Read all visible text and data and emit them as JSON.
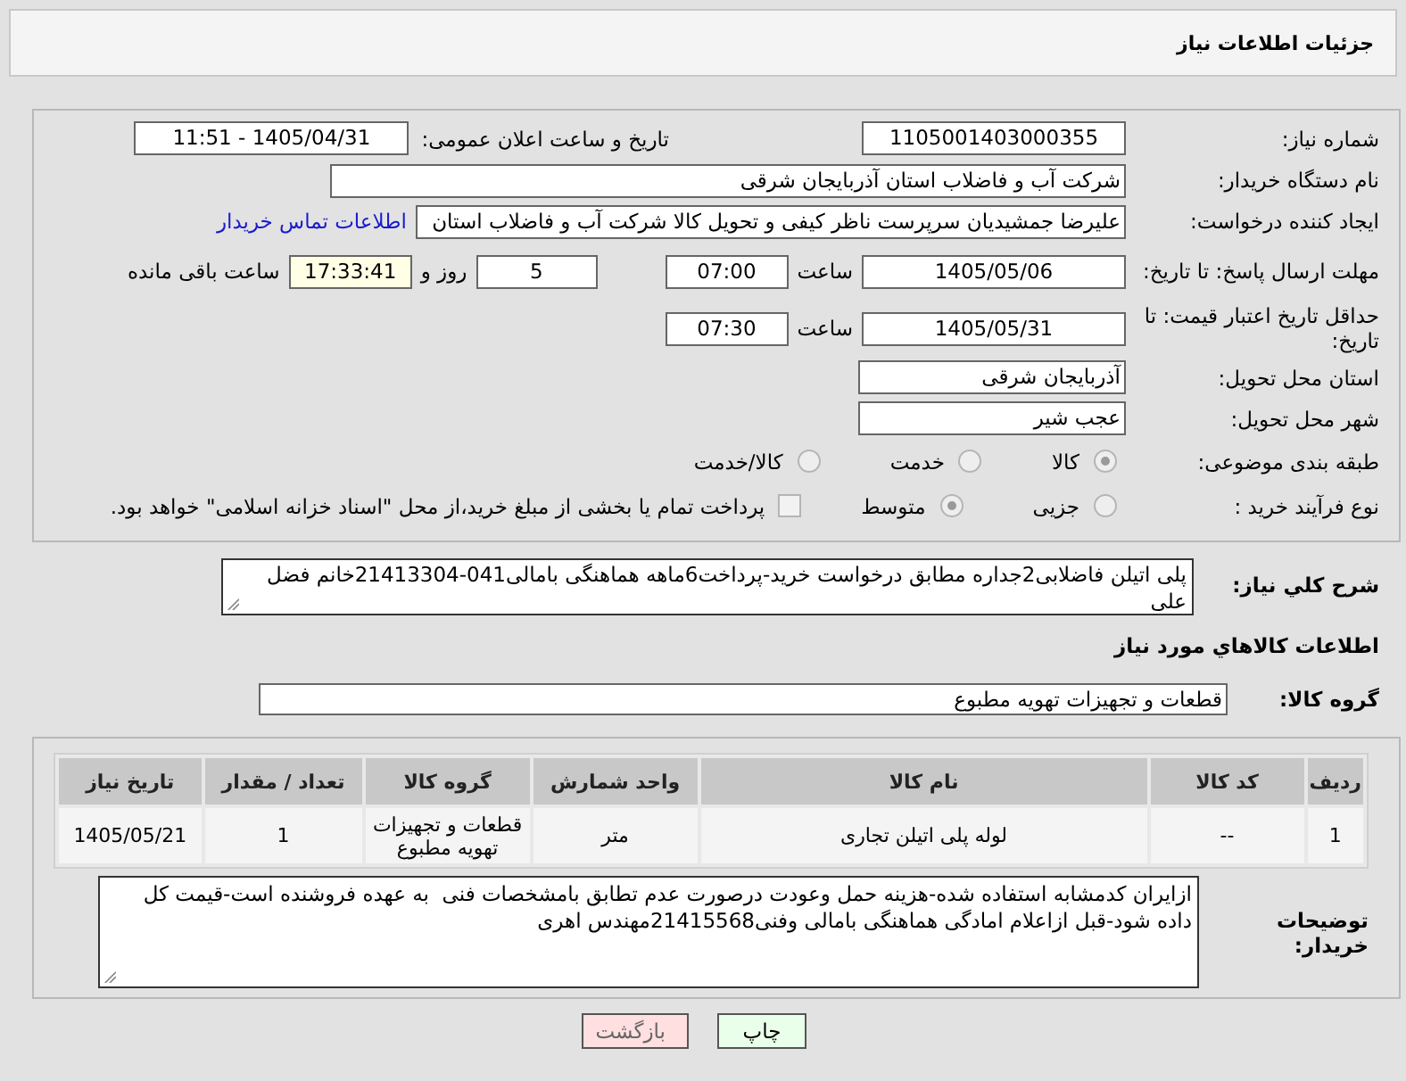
{
  "window": {
    "title": "جزئیات اطلاعات نیاز"
  },
  "need_number": {
    "label": "شماره نیاز:",
    "value": "1105001403000355"
  },
  "announce": {
    "label": "تاریخ و ساعت اعلان عمومی:",
    "value": "1405/04/31 - 11:51"
  },
  "buyer_org": {
    "label": "نام دستگاه خریدار:",
    "value": "شرکت آب و فاضلاب استان آذربایجان شرقی"
  },
  "requester": {
    "label": "ایجاد کننده درخواست:",
    "value": "علیرضا جمشیدیان سرپرست ناظر کیفی و تحویل کالا شرکت آب و فاضلاب استان",
    "link": "اطلاعات تماس خریدار"
  },
  "reply_deadline": {
    "label": "مهلت ارسال پاسخ: تا تاریخ:",
    "date": "1405/05/06",
    "time_label": "ساعت",
    "time": "07:00",
    "days": "5",
    "days_label": "روز و",
    "remaining": "17:33:41",
    "remaining_label": "ساعت باقی مانده"
  },
  "price_validity": {
    "label": "حداقل تاریخ اعتبار قیمت: تا تاریخ:",
    "date": "1405/05/31",
    "time_label": "ساعت",
    "time": "07:30"
  },
  "province": {
    "label": "استان محل تحویل:",
    "value": "آذربایجان شرقی"
  },
  "city": {
    "label": "شهر محل تحویل:",
    "value": "عجب شیر"
  },
  "category": {
    "label": "طبقه بندی موضوعی:",
    "options": [
      {
        "label": "کالا",
        "selected": true
      },
      {
        "label": "خدمت",
        "selected": false
      },
      {
        "label": "کالا/خدمت",
        "selected": false
      }
    ]
  },
  "process": {
    "label": "نوع فرآیند خرید :",
    "options": [
      {
        "label": "جزیی",
        "selected": false
      },
      {
        "label": "متوسط",
        "selected": true
      }
    ],
    "treasury": {
      "label": "پرداخت تمام یا بخشی از مبلغ خرید،از محل \"اسناد خزانه اسلامی\" خواهد بود.",
      "checked": false
    }
  },
  "description": {
    "label": "شرح کلي نياز:",
    "value": "پلی اتیلن فاضلابی2جداره مطابق درخواست خرید-پرداخت6ماهه هماهنگی بامالی041-21413304خانم فضل علی"
  },
  "goods_heading": "اطلاعات کالاهاي مورد نياز",
  "goods_group": {
    "label": "گروه کالا:",
    "value": "قطعات و تجهیزات تهویه مطبوع"
  },
  "table": {
    "columns": [
      "ردیف",
      "کد کالا",
      "نام کالا",
      "واحد شمارش",
      "گروه کالا",
      "تعداد / مقدار",
      "تاریخ نیاز"
    ],
    "rows": [
      [
        "1",
        "--",
        "لوله پلی اتیلن تجاری",
        "متر",
        "قطعات و تجهیزات تهویه مطبوع",
        "1",
        "1405/05/21"
      ]
    ]
  },
  "buyer_notes": {
    "label": "توضیحات خریدار:",
    "value": "ازایران کدمشابه استفاده شده-هزینه حمل وعودت درصورت عدم تطابق بامشخصات فنی  به عهده فروشنده است-قیمت کل داده شود-قبل ازاعلام امادگی هماهنگی بامالی وفنی21415568مهندس اهری"
  },
  "buttons": [
    {
      "label": "چاپ",
      "kind": "print"
    },
    {
      "label": "بازگشت",
      "kind": "back"
    }
  ]
}
